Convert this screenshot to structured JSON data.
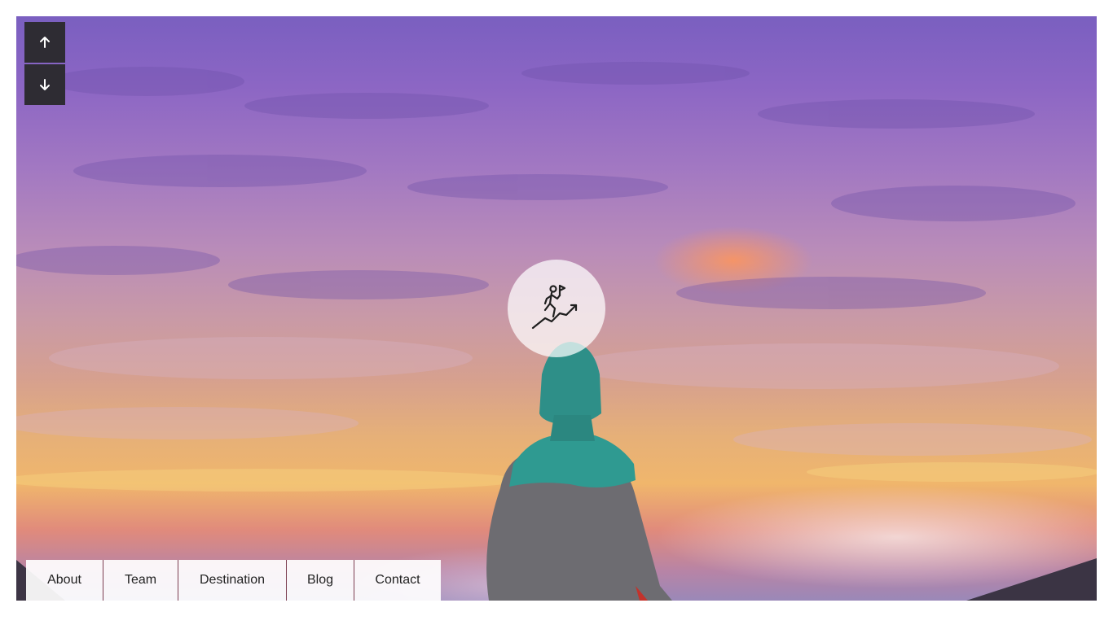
{
  "page": {
    "background": "#ffffff"
  },
  "scroll_buttons": {
    "up_icon": "arrow-up-icon",
    "down_icon": "arrow-down-icon",
    "color": "#2e2c33"
  },
  "badge": {
    "icon": "hiker-climbing-flag-icon"
  },
  "nav": {
    "items": [
      {
        "label": "About"
      },
      {
        "label": "Team"
      },
      {
        "label": "Destination"
      },
      {
        "label": "Blog"
      },
      {
        "label": "Contact"
      }
    ],
    "divider_color": "#7d3f52"
  }
}
